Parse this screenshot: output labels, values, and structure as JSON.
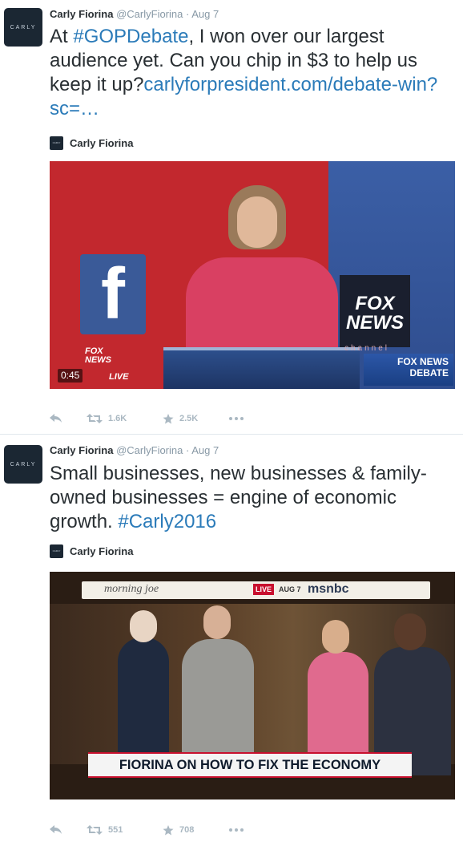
{
  "tweets": [
    {
      "avatar_text": "CARLY",
      "fullname": "Carly Fiorina",
      "handle": "@CarlyFiorina",
      "separator": "·",
      "time": "Aug 7",
      "text_prefix": "At ",
      "hashtag": "#GOPDebate",
      "text_middle": ", I won over our largest audience yet. Can you chip in $3 to help us keep it up?",
      "link": "carlyforpresident.com/debate-win?sc=…",
      "card_author": "Carly Fiorina",
      "media": {
        "duration": "0:45",
        "sign_letter": "f",
        "fox_logo": "FOX NEWS",
        "channel_text": "channel",
        "debate_logo_line1": "FOX NEWS",
        "debate_logo_line2": "DEBATE",
        "live_bug_line1": "FOX",
        "live_bug_line2": "NEWS",
        "live_bug_line3": "LIVE"
      },
      "retweets": "1.6K",
      "favorites": "2.5K"
    },
    {
      "avatar_text": "CARLY",
      "fullname": "Carly Fiorina",
      "handle": "@CarlyFiorina",
      "separator": "·",
      "time": "Aug 7",
      "text_prefix": "Small businesses, new businesses & family-owned businesses = engine of economic growth. ",
      "hashtag": "#Carly2016",
      "card_author": "Carly Fiorina",
      "media": {
        "show_name": "morning joe",
        "live_label": "LIVE",
        "date_label": "AUG 7",
        "network": "msnbc",
        "chyron": "FIORINA ON HOW TO FIX THE ECONOMY"
      },
      "retweets": "551",
      "favorites": "708"
    }
  ],
  "icons": {
    "reply": "reply-icon",
    "retweet": "retweet-icon",
    "favorite": "star-icon",
    "more": "more-icon"
  },
  "colors": {
    "link": "#2b7bb9",
    "action_gray": "#aab8c2",
    "meta_gray": "#8899a6"
  }
}
